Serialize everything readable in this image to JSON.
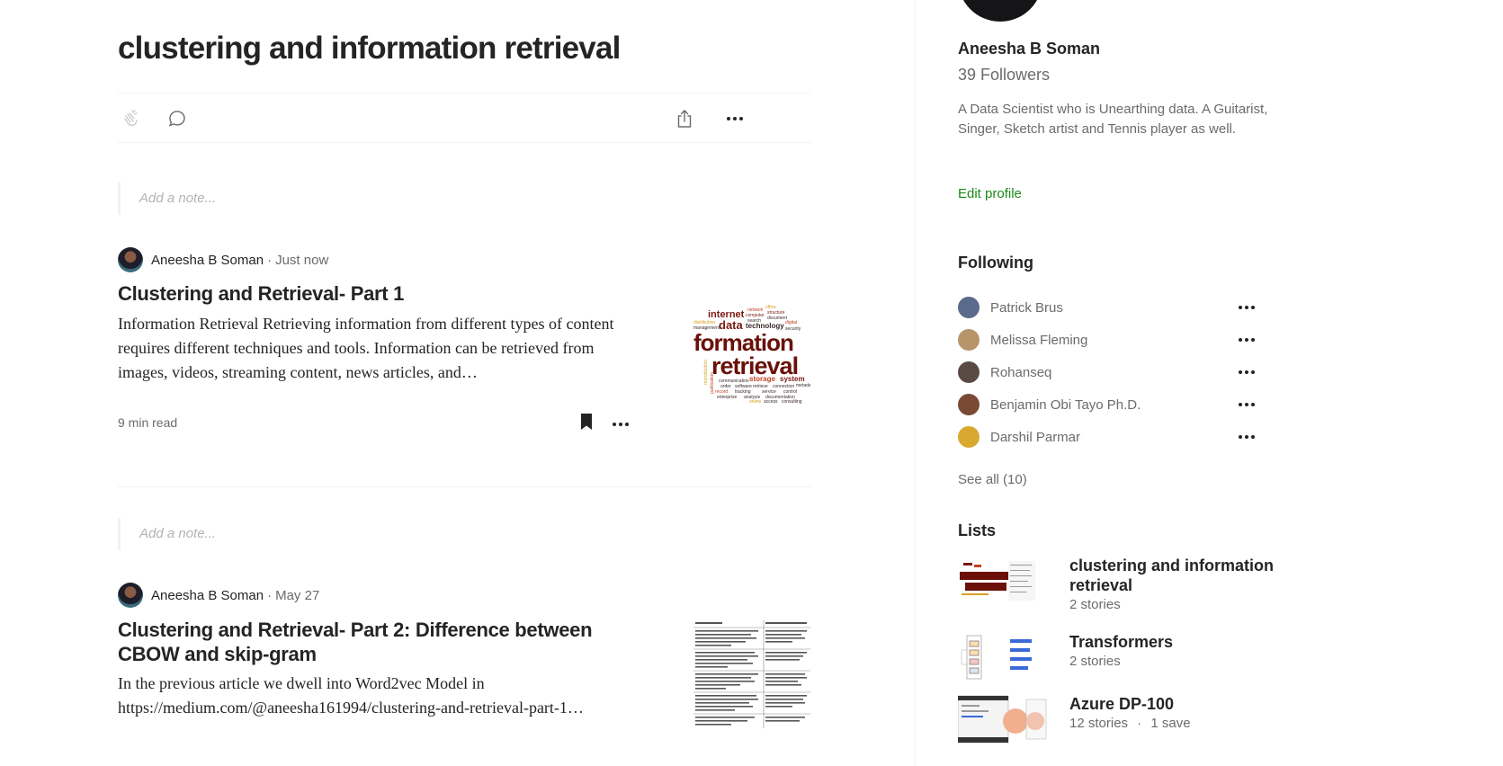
{
  "list": {
    "title": "clustering and information retrieval",
    "note_placeholder": "Add a note..."
  },
  "posts": [
    {
      "author": "Aneesha B Soman",
      "time": "Just now",
      "title": "Clustering and Retrieval- Part 1",
      "excerpt": "Information Retrieval Retrieving information from different types of content requires different techniques and tools. Information can be retrieved from images, videos, streaming content, news articles, and…",
      "read_time": "9 min read",
      "thumb": {
        "words": [
          "internet",
          "network",
          "office",
          "computer",
          "structure",
          "search",
          "document",
          "data",
          "technology",
          "digital",
          "security",
          "formation",
          "retrieval",
          "communication",
          "storage",
          "system",
          "software",
          "order",
          "retrieve",
          "connection",
          "record",
          "tracking",
          "service",
          "control",
          "enterprise",
          "analysis",
          "documentation",
          "online",
          "access",
          "consulting",
          "distribution",
          "management",
          "metadata",
          "reproduction",
          "publication"
        ]
      }
    },
    {
      "author": "Aneesha B Soman",
      "time": "May 27",
      "title": "Clustering and Retrieval- Part 2: Difference between CBOW and skip-gram",
      "excerpt": "In the previous article we dwell into Word2vec Model in https://medium.com/@aneesha161994/clustering-and-retrieval-part-1…"
    }
  ],
  "profile": {
    "name": "Aneesha B Soman",
    "followers": "39 Followers",
    "bio": "A Data Scientist who is Unearthing data. A Guitarist, Singer, Sketch artist and Tennis player as well.",
    "edit_label": "Edit profile"
  },
  "following": {
    "heading": "Following",
    "people": [
      {
        "name": "Patrick Brus",
        "color": "#5a6a8a"
      },
      {
        "name": "Melissa Fleming",
        "color": "#b8946a"
      },
      {
        "name": "Rohanseq",
        "color": "#5a4a44"
      },
      {
        "name": "Benjamin Obi Tayo Ph.D.",
        "color": "#7a4a34"
      },
      {
        "name": "Darshil Parmar",
        "color": "#d8a830"
      }
    ],
    "see_all": "See all (10)"
  },
  "lists_section": {
    "heading": "Lists",
    "items": [
      {
        "title": "clustering and information retrieval",
        "stories": "2 stories",
        "saves": ""
      },
      {
        "title": "Transformers",
        "stories": "2 stories",
        "saves": ""
      },
      {
        "title": "Azure DP-100",
        "stories": "12 stories",
        "saves": "1 save"
      }
    ]
  },
  "colors": {
    "accent_green": "#1a8917",
    "text_primary": "#242424",
    "text_secondary": "#6b6b6b",
    "divider": "#f2f2f2"
  },
  "icons": {
    "clap": "clap-icon",
    "comment": "comment-icon",
    "share": "share-icon",
    "more": "more-icon",
    "bookmark": "bookmark-filled-icon"
  }
}
